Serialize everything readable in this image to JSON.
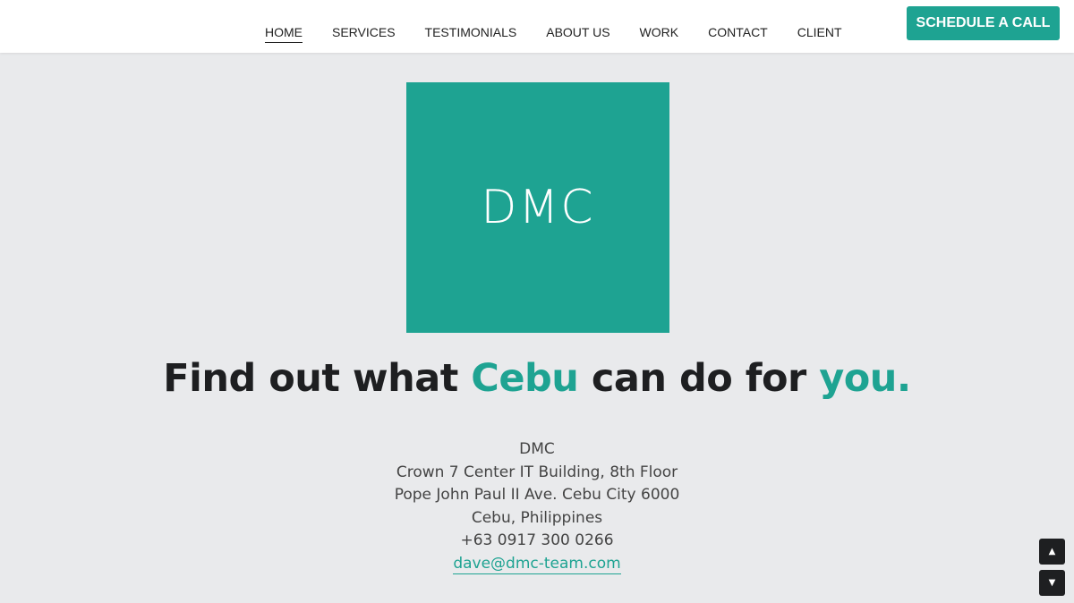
{
  "nav": {
    "items": [
      {
        "label": "HOME",
        "active": true
      },
      {
        "label": "SERVICES"
      },
      {
        "label": "TESTIMONIALS"
      },
      {
        "label": "ABOUT US"
      },
      {
        "label": "WORK"
      },
      {
        "label": "CONTACT"
      },
      {
        "label": "CLIENT"
      }
    ],
    "cta_label": "SCHEDULE A CALL"
  },
  "logo": {
    "text": "DMC"
  },
  "headline": {
    "part1": "Find out what ",
    "accent1": "Cebu",
    "part2": " can do for ",
    "accent2": "you."
  },
  "address": {
    "company": "DMC",
    "line1": "Crown 7 Center IT Building, 8th Floor",
    "line2": "Pope John Paul II Ave. Cebu City 6000",
    "line3": "Cebu, Philippines",
    "phone": "+63 0917 300 0266",
    "email": "dave@dmc-team.com"
  },
  "scroll": {
    "up_icon": "▲",
    "down_icon": "▼"
  },
  "colors": {
    "accent": "#1ea392",
    "background": "#e9eaec",
    "dark": "#1e1f21"
  }
}
